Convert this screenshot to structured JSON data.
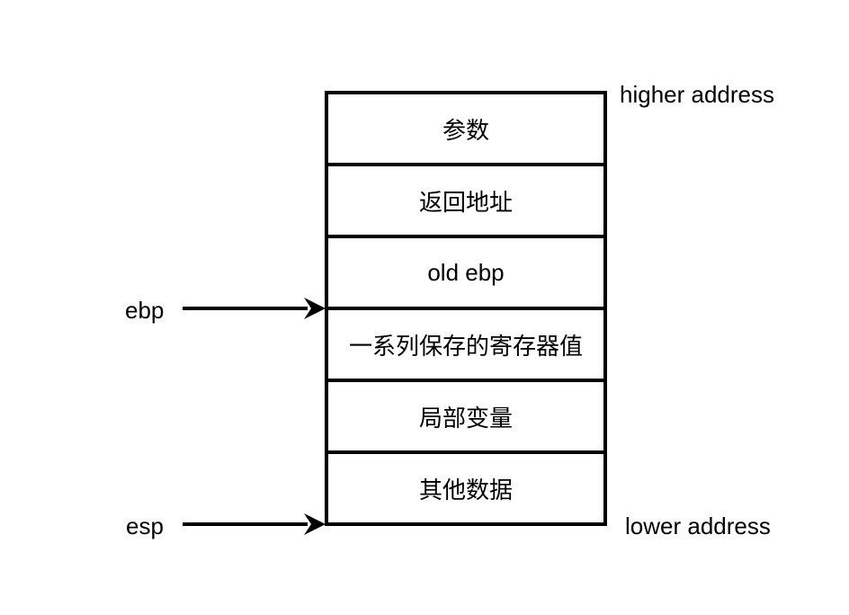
{
  "stack": {
    "cells": [
      {
        "label": "参数"
      },
      {
        "label": "返回地址"
      },
      {
        "label": "old ebp"
      },
      {
        "label": "一系列保存的寄存器值"
      },
      {
        "label": "局部变量"
      },
      {
        "label": "其他数据"
      }
    ]
  },
  "annotations": {
    "higher": "higher address",
    "lower": "lower address"
  },
  "pointers": {
    "ebp": "ebp",
    "esp": "esp"
  }
}
